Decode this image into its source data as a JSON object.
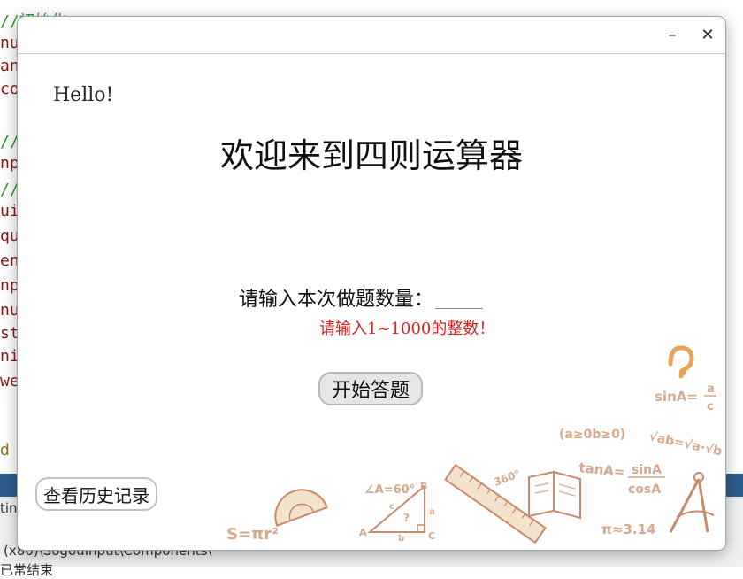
{
  "background": {
    "code_fragments": [
      {
        "text": "//初始化",
        "color": "#2a9a2a"
      },
      {
        "text": "nu",
        "color": "#8a1a1a"
      },
      {
        "text": "an",
        "color": "#8a1a1a"
      },
      {
        "text": "co",
        "color": "#8a1a1a"
      },
      {
        "text": "",
        "color": "#8a1a1a"
      },
      {
        "text": "//显",
        "color": "#2a9a2a"
      },
      {
        "text": "np",
        "color": "#8a1a1a"
      },
      {
        "text": "//捕",
        "color": "#2a9a2a"
      },
      {
        "text": "ui-",
        "color": "#8a1a1a"
      },
      {
        "text": "qu",
        "color": "#8a1a1a"
      },
      {
        "text": "en",
        "color": "#8a1a1a"
      },
      {
        "text": "np",
        "color": "#8a1a1a"
      },
      {
        "text": "nu",
        "color": "#8a1a1a"
      },
      {
        "text": "sta",
        "color": "#8a1a1a"
      },
      {
        "text": "nis",
        "color": "#8a1a1a"
      },
      {
        "text": "we",
        "color": "#8a1a1a"
      },
      {
        "text": "",
        "color": "#8a1a1a"
      },
      {
        "text": "",
        "color": "#8a1a1a"
      },
      {
        "text": "d",
        "color": "#8a7a1a"
      }
    ],
    "panel_lines": [
      "tin",
      " (x86)\\SogouInput\\Components\\",
      "已常结束"
    ]
  },
  "dialog": {
    "minimize_glyph": "–",
    "close_glyph": "✕",
    "hello": "Hello!",
    "title": "欢迎来到四则运算器",
    "prompt_label": "请输入本次做题数量：",
    "count_value": "",
    "hint": "请输入1~1000的整数！",
    "start_button": "开始答题",
    "history_button": "查看历史记录"
  },
  "doodles": {
    "sin": "sinA=",
    "sin_frac_top": "a",
    "sin_frac_bot": "c",
    "ineq": "(a≥0b≥0)",
    "sqrt": "√ab=√a·√b",
    "tan": "tanA=",
    "tan_top": "sinA",
    "tan_bot": "cosA",
    "pi": "π≈3.14",
    "area": "S=πr²",
    "angle": "∠A=60°",
    "deg": "360°",
    "tri_a": "A",
    "tri_b": "B",
    "tri_c": "C",
    "tri_side_a": "a",
    "tri_side_b": "b",
    "tri_side_c": "c",
    "tri_q": "?",
    "accent_color": "#d8a98b"
  }
}
